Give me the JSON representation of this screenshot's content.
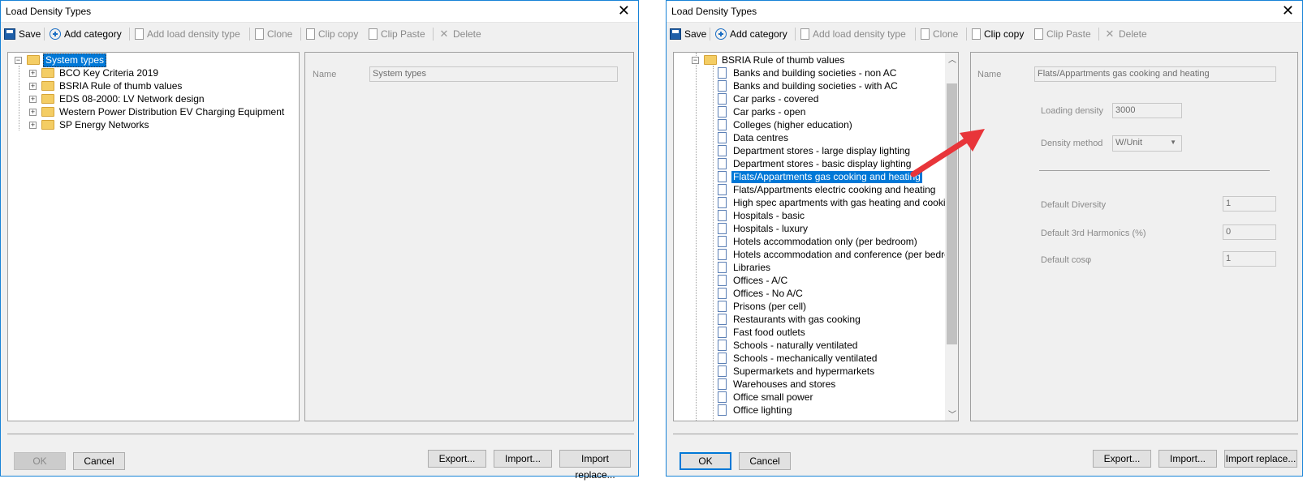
{
  "left": {
    "title": "Load Density Types",
    "toolbar": {
      "save": "Save",
      "add_category": "Add category",
      "add_load_density_type": "Add load density type",
      "clone": "Clone",
      "clip_copy": "Clip copy",
      "clip_paste": "Clip Paste",
      "delete": "Delete"
    },
    "tree": {
      "root": "System types",
      "children": [
        "BCO Key Criteria 2019",
        "BSRIA Rule of thumb values",
        "EDS 08-2000: LV Network design",
        "Western Power Distribution EV Charging Equipment",
        "SP Energy Networks"
      ]
    },
    "props": {
      "name_label": "Name",
      "name_value": "System types"
    },
    "buttons": {
      "ok": "OK",
      "cancel": "Cancel",
      "export": "Export...",
      "import": "Import...",
      "import_replace": "Import replace..."
    }
  },
  "right": {
    "title": "Load Density Types",
    "toolbar": {
      "save": "Save",
      "add_category": "Add category",
      "add_load_density_type": "Add load density type",
      "clone": "Clone",
      "clip_copy": "Clip copy",
      "clip_paste": "Clip Paste",
      "delete": "Delete"
    },
    "tree": {
      "parent": "BSRIA Rule of thumb values",
      "items": [
        "Banks and building societies - non AC",
        "Banks and building societies - with AC",
        "Car parks - covered",
        "Car parks - open",
        "Colleges (higher education)",
        "Data centres",
        "Department stores - large display lighting",
        "Department stores - basic display lighting",
        "Flats/Appartments gas cooking and heating",
        "Flats/Appartments electric cooking and heating",
        "High spec apartments with gas heating and cooking",
        "Hospitals - basic",
        "Hospitals - luxury",
        "Hotels accommodation only (per bedroom)",
        "Hotels accommodation and conference (per bedroom)",
        "Libraries",
        "Offices - A/C",
        "Offices - No A/C",
        "Prisons (per cell)",
        "Restaurants with gas cooking",
        "Fast food outlets",
        "Schools - naturally ventilated",
        "Schools - mechanically ventilated",
        "Supermarkets and hypermarkets",
        "Warehouses and stores",
        "Office small power",
        "Office lighting"
      ],
      "selected_index": 8
    },
    "props": {
      "name_label": "Name",
      "name_value": "Flats/Appartments gas cooking and heating",
      "loading_density_label": "Loading density",
      "loading_density_value": "3000",
      "density_method_label": "Density method",
      "density_method_value": "W/Unit",
      "default_diversity_label": "Default Diversity",
      "default_diversity_value": "1",
      "default_3rd_harmonics_label": "Default 3rd Harmonics (%)",
      "default_3rd_harmonics_value": "0",
      "default_cosphi_label": "Default cosφ",
      "default_cosphi_value": "1"
    },
    "buttons": {
      "ok": "OK",
      "cancel": "Cancel",
      "export": "Export...",
      "import": "Import...",
      "import_replace": "Import replace..."
    },
    "annotation_color": "#e8353a"
  }
}
